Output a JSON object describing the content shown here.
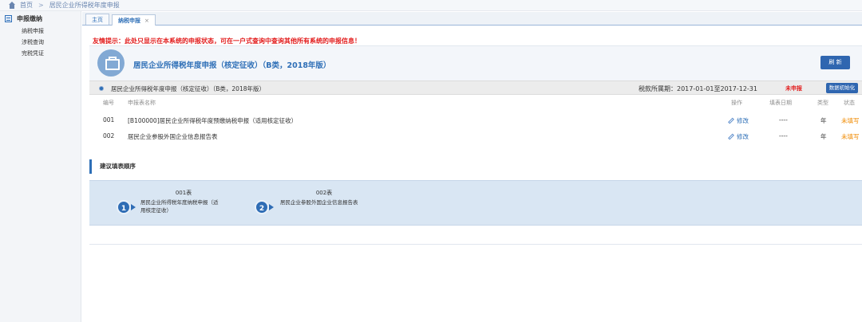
{
  "breadcrumb": {
    "home": "首页",
    "separator": ">",
    "current": "居民企业所得税年度申报"
  },
  "sidebar": {
    "title": "申报缴纳",
    "items": [
      {
        "label": "纳税申报"
      },
      {
        "label": "涉税查询"
      },
      {
        "label": "完税凭证"
      }
    ]
  },
  "tabs": [
    {
      "label": "主页"
    },
    {
      "label": "纳税申报",
      "close": "×"
    }
  ],
  "warning": "友情提示：此处只显示在本系统的申报状态，可在一户式查询中查询其他所有系统的申报信息！",
  "header": {
    "title": "居民企业所得税年度申报（核定征收）（B类，2018年版）",
    "refresh_label": "刷 新"
  },
  "strip": {
    "form_name": "居民企业所得税年度申报（核定征收）（B类，2018年版）",
    "period": "税款所属期：2017-01-01至2017-12-31",
    "status": "未申报",
    "init_label": "数据初始化"
  },
  "table": {
    "headers": {
      "no": "编号",
      "name": "申报表名称",
      "action": "操作",
      "date": "填表日期",
      "type": "类型",
      "status": "状态"
    },
    "rows": [
      {
        "no": "001",
        "name": "[B100000]居民企业所得税年度预缴纳税申报（适用核定征收）",
        "action": "修改",
        "date": "----",
        "type": "年",
        "status": "未填写"
      },
      {
        "no": "002",
        "name": "居民企业参股外国企业信息报告表",
        "action": "修改",
        "date": "----",
        "type": "年",
        "status": "未填写"
      }
    ]
  },
  "section": {
    "title": "建议填表顺序"
  },
  "steps": [
    {
      "num": "1",
      "label": "001表",
      "text_line1": "居民企业所得税年度纳税申报（适",
      "text_line2": "用核定征收）"
    },
    {
      "num": "2",
      "label": "002表",
      "text_line1": "居民企业参股外国企业信息报告表",
      "text_line2": ""
    }
  ]
}
